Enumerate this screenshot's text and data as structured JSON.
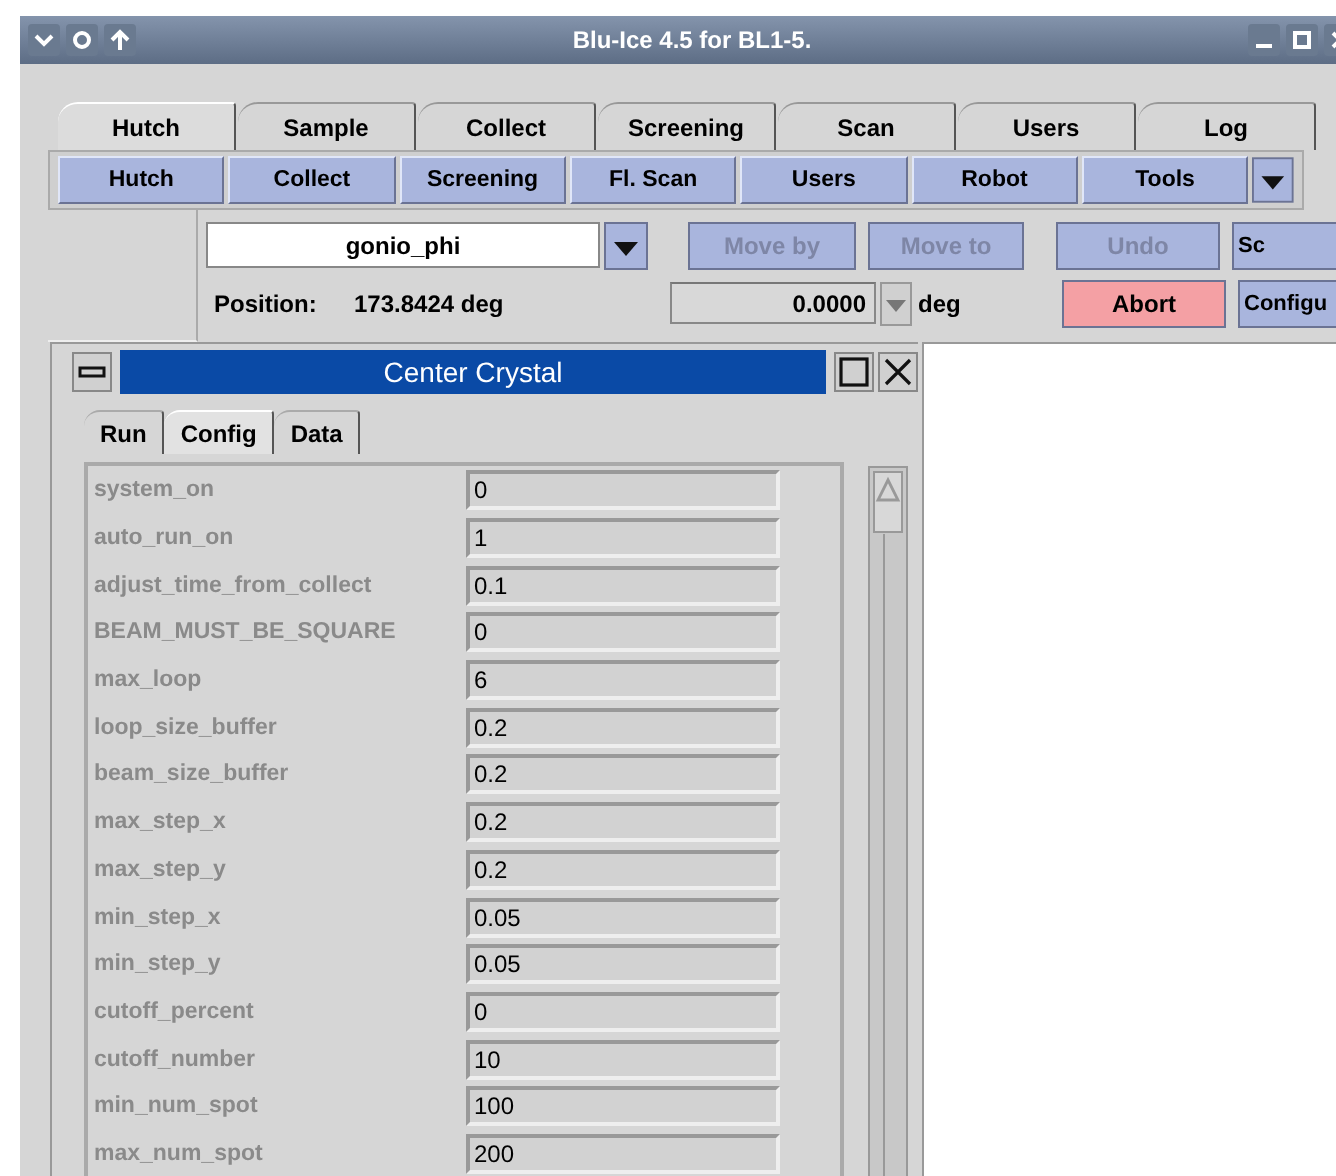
{
  "window": {
    "title": "Blu-Ice 4.5 for BL1-5."
  },
  "tabs": [
    {
      "label": "Hutch",
      "selected": true
    },
    {
      "label": "Sample",
      "selected": false
    },
    {
      "label": "Collect",
      "selected": false
    },
    {
      "label": "Screening",
      "selected": false
    },
    {
      "label": "Scan",
      "selected": false
    },
    {
      "label": "Users",
      "selected": false
    },
    {
      "label": "Log",
      "selected": false
    }
  ],
  "toolbar": [
    {
      "label": "Hutch",
      "kind": "button"
    },
    {
      "label": "Collect",
      "kind": "button"
    },
    {
      "label": "Screening",
      "kind": "button"
    },
    {
      "label": "Fl. Scan",
      "kind": "button"
    },
    {
      "label": "Users",
      "kind": "button"
    },
    {
      "label": "Robot",
      "kind": "button"
    },
    {
      "label": "Tools",
      "kind": "menu"
    }
  ],
  "motor": {
    "name": "gonio_phi",
    "position_label": "Position:",
    "position": "173.8424 deg",
    "step": "0.0000",
    "step_unit": "deg"
  },
  "motor_buttons": [
    {
      "label": "Move by",
      "disabled": true
    },
    {
      "label": "Move to",
      "disabled": true
    },
    {
      "label": "Undo",
      "disabled": true
    },
    {
      "label": "Sc",
      "disabled": false
    },
    {
      "label": "Abort",
      "disabled": false
    },
    {
      "label": "Configu",
      "disabled": false
    }
  ],
  "dialog": {
    "title": "Center Crystal",
    "tabs": [
      {
        "label": "Run",
        "selected": false
      },
      {
        "label": "Config",
        "selected": true
      },
      {
        "label": "Data",
        "selected": false
      }
    ],
    "params": [
      {
        "name": "system_on",
        "value": "0",
        "disabled": true
      },
      {
        "name": "auto_run_on",
        "value": "1",
        "disabled": true
      },
      {
        "name": "adjust_time_from_collect",
        "value": "0.1",
        "disabled": true
      },
      {
        "name": "BEAM_MUST_BE_SQUARE",
        "value": "0",
        "disabled": true
      },
      {
        "name": "max_loop",
        "value": "6",
        "disabled": true
      },
      {
        "name": "loop_size_buffer",
        "value": "0.2",
        "disabled": true
      },
      {
        "name": "beam_size_buffer",
        "value": "0.2",
        "disabled": true
      },
      {
        "name": "max_step_x",
        "value": "0.2",
        "disabled": true
      },
      {
        "name": "max_step_y",
        "value": "0.2",
        "disabled": true
      },
      {
        "name": "min_step_x",
        "value": "0.05",
        "disabled": true
      },
      {
        "name": "min_step_y",
        "value": "0.05",
        "disabled": true
      },
      {
        "name": "cutoff_percent",
        "value": "0",
        "disabled": true
      },
      {
        "name": "cutoff_number",
        "value": "10",
        "disabled": true
      },
      {
        "name": "min_num_spot",
        "value": "100",
        "disabled": true
      },
      {
        "name": "max_num_spot",
        "value": "200",
        "disabled": true
      }
    ]
  }
}
